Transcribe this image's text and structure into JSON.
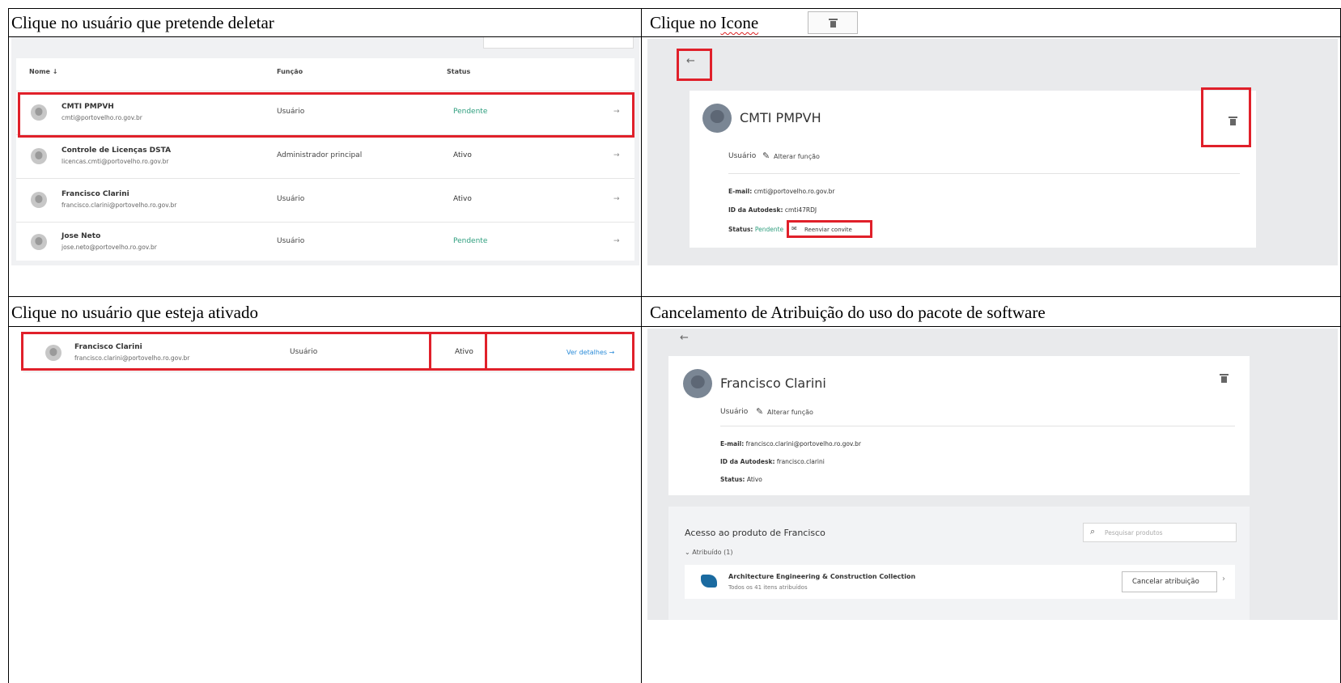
{
  "cells": {
    "top_left_title": "Clique no usuário que pretende deletar",
    "top_right_title_prefix": "Clique no ",
    "top_right_title_word": "Icone",
    "bottom_left_title": "Clique no usuário que esteja ativado",
    "bottom_right_title": "Cancelamento de Atribuição do uso do pacote de software"
  },
  "user_table": {
    "columns": {
      "name": "Nome ↓",
      "role": "Função",
      "status": "Status"
    },
    "rows": [
      {
        "name": "CMTI PMPVH",
        "email": "cmti@portovelho.ro.gov.br",
        "role": "Usuário",
        "status": "Pendente",
        "arrow": "→"
      },
      {
        "name": "Controle de Licenças DSTA",
        "email": "licencas.cmti@portovelho.ro.gov.br",
        "role": "Administrador principal",
        "status": "Ativo",
        "arrow": "→"
      },
      {
        "name": "Francisco Clarini",
        "email": "francisco.clarini@portovelho.ro.gov.br",
        "role": "Usuário",
        "status": "Ativo",
        "arrow": "→"
      },
      {
        "name": "Jose Neto",
        "email": "jose.neto@portovelho.ro.gov.br",
        "role": "Usuário",
        "status": "Pendente",
        "arrow": "→"
      }
    ]
  },
  "detail_pending": {
    "back": "←",
    "name": "CMTI PMPVH",
    "role": "Usuário",
    "change_role": "Alterar função",
    "email_label": "E-mail:",
    "email": "cmti@portovelho.ro.gov.br",
    "autodesk_label": "ID da Autodesk:",
    "autodesk_id": "cmti47RDJ",
    "status_label": "Status:",
    "status": "Pendente",
    "resend": "Reenviar convite"
  },
  "active_row": {
    "name": "Francisco Clarini",
    "email": "francisco.clarini@portovelho.ro.gov.br",
    "role": "Usuário",
    "status": "Ativo",
    "details": "Ver detalhes →"
  },
  "detail_active": {
    "back": "←",
    "name": "Francisco Clarini",
    "role": "Usuário",
    "change_role": "Alterar função",
    "email_label": "E-mail:",
    "email": "francisco.clarini@portovelho.ro.gov.br",
    "autodesk_label": "ID da Autodesk:",
    "autodesk_id": "francisco.clarini",
    "status_label": "Status:",
    "status": "Ativo",
    "access_title": "Acesso ao produto de Francisco",
    "search_placeholder": "Pesquisar produtos",
    "assigned": "Atribuído (1)",
    "product_name": "Architecture Engineering & Construction Collection",
    "product_sub": "Todos os 41 itens atribuídos",
    "cancel_button": "Cancelar atribuição",
    "chevron": "›"
  },
  "colors": {
    "pending": "#2e9e7e",
    "link": "#2a8bd8",
    "highlight": "#e0202a"
  }
}
